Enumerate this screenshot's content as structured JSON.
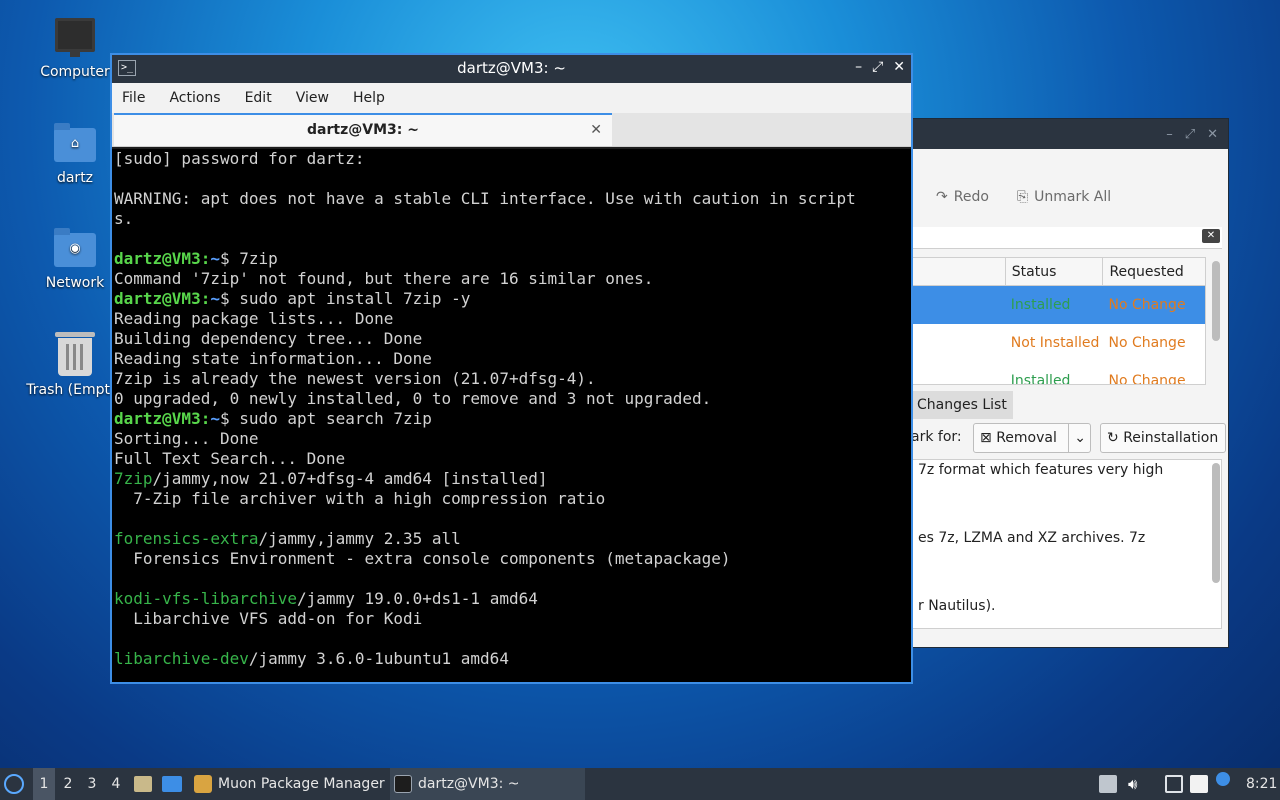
{
  "desktop": {
    "icons": [
      {
        "label": "Computer",
        "icon": "computer-icon"
      },
      {
        "label": "dartz",
        "icon": "home-folder-icon"
      },
      {
        "label": "Network",
        "icon": "network-folder-icon"
      },
      {
        "label": "Trash (Empty)",
        "icon": "trash-icon"
      }
    ]
  },
  "muon": {
    "toolbar": {
      "redo": "Redo",
      "unmark_all": "Unmark All"
    },
    "table": {
      "headers": [
        "",
        "Status",
        "Requested"
      ],
      "rows": [
        {
          "status": "Installed",
          "requested": "No Change",
          "selected": true
        },
        {
          "status": "Not Installed",
          "requested": "No Change",
          "selected": false
        },
        {
          "status": "Installed",
          "requested": "No Change",
          "selected": false
        }
      ]
    },
    "tab_changes": "Changes List",
    "mark_for": "ark for:",
    "removal": "Removal",
    "reinstallation": "Reinstallation",
    "desc_lines": [
      "7z format which features very high",
      "es 7z, LZMA and XZ archives. 7z",
      "r Nautilus)."
    ],
    "colors": {
      "installed": "#2e9e4f",
      "not_installed": "#e07b1f",
      "no_change": "#e07b1f",
      "selection": "#3d8ee6"
    }
  },
  "terminal": {
    "title": "dartz@VM3: ~",
    "tab_title": "dartz@VM3: ~",
    "menu": [
      "File",
      "Actions",
      "Edit",
      "View",
      "Help"
    ],
    "lines": [
      {
        "t": "text",
        "text": "[sudo] password for dartz:"
      },
      {
        "t": "text",
        "text": ""
      },
      {
        "t": "text",
        "text": "WARNING: apt does not have a stable CLI interface. Use with caution in script"
      },
      {
        "t": "text",
        "text": "s."
      },
      {
        "t": "text",
        "text": ""
      },
      {
        "t": "prompt",
        "user": "dartz@VM3",
        "path": "~",
        "cmd": "$ 7zip"
      },
      {
        "t": "text",
        "text": "Command '7zip' not found, but there are 16 similar ones."
      },
      {
        "t": "prompt",
        "user": "dartz@VM3",
        "path": "~",
        "cmd": "$ sudo apt install 7zip -y"
      },
      {
        "t": "text",
        "text": "Reading package lists... Done"
      },
      {
        "t": "text",
        "text": "Building dependency tree... Done"
      },
      {
        "t": "text",
        "text": "Reading state information... Done"
      },
      {
        "t": "text",
        "text": "7zip is already the newest version (21.07+dfsg-4)."
      },
      {
        "t": "text",
        "text": "0 upgraded, 0 newly installed, 0 to remove and 3 not upgraded."
      },
      {
        "t": "prompt",
        "user": "dartz@VM3",
        "path": "~",
        "cmd": "$ sudo apt search 7zip"
      },
      {
        "t": "text",
        "text": "Sorting... Done"
      },
      {
        "t": "text",
        "text": "Full Text Search... Done"
      },
      {
        "t": "pkg",
        "pkg": "7zip",
        "rest": "/jammy,now 21.07+dfsg-4 amd64 [installed]"
      },
      {
        "t": "text",
        "text": "  7-Zip file archiver with a high compression ratio"
      },
      {
        "t": "text",
        "text": ""
      },
      {
        "t": "pkg",
        "pkg": "forensics-extra",
        "rest": "/jammy,jammy 2.35 all"
      },
      {
        "t": "text",
        "text": "  Forensics Environment - extra console components (metapackage)"
      },
      {
        "t": "text",
        "text": ""
      },
      {
        "t": "pkg",
        "pkg": "kodi-vfs-libarchive",
        "rest": "/jammy 19.0.0+ds1-1 amd64"
      },
      {
        "t": "text",
        "text": "  Libarchive VFS add-on for Kodi"
      },
      {
        "t": "text",
        "text": ""
      },
      {
        "t": "pkg",
        "pkg": "libarchive-dev",
        "rest": "/jammy 3.6.0-1ubuntu1 amd64"
      }
    ]
  },
  "taskbar": {
    "workspaces": [
      "1",
      "2",
      "3",
      "4"
    ],
    "active_workspace": "1",
    "tasks": [
      {
        "label": "Muon Package Manager",
        "icon": "muon-icon"
      },
      {
        "label": "dartz@VM3: ~",
        "icon": "terminal-icon"
      }
    ],
    "clock": "8:21"
  }
}
